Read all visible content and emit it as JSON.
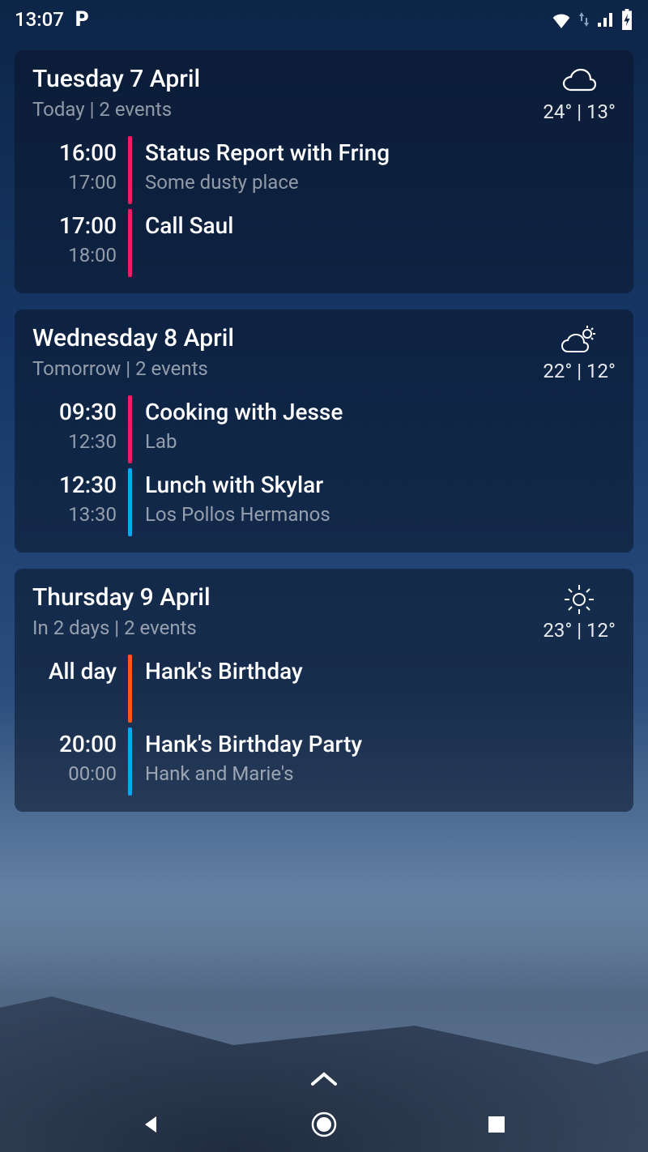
{
  "status": {
    "time": "13:07"
  },
  "colors": {
    "pink": "#e91e63",
    "blue": "#03a9f4",
    "orange": "#ff5722"
  },
  "days": [
    {
      "title": "Tuesday 7 April",
      "sub": "Today | 2 events",
      "weather": {
        "icon": "cloud",
        "temps": "24° | 13°"
      },
      "events": [
        {
          "start": "16:00",
          "end": "17:00",
          "color": "pink",
          "title": "Status Report with Fring",
          "loc": "Some dusty place"
        },
        {
          "start": "17:00",
          "end": "18:00",
          "color": "pink",
          "title": "Call Saul",
          "loc": ""
        }
      ]
    },
    {
      "title": "Wednesday 8 April",
      "sub": "Tomorrow | 2 events",
      "weather": {
        "icon": "partly",
        "temps": "22° | 12°"
      },
      "events": [
        {
          "start": "09:30",
          "end": "12:30",
          "color": "pink",
          "title": "Cooking with Jesse",
          "loc": "Lab"
        },
        {
          "start": "12:30",
          "end": "13:30",
          "color": "blue",
          "title": "Lunch with Skylar",
          "loc": "Los Pollos Hermanos"
        }
      ]
    },
    {
      "title": "Thursday 9 April",
      "sub": "In 2 days | 2 events",
      "weather": {
        "icon": "sun",
        "temps": "23° | 12°"
      },
      "events": [
        {
          "allday": "All day",
          "color": "orange",
          "title": "Hank's Birthday",
          "loc": ""
        },
        {
          "start": "20:00",
          "end": "00:00",
          "color": "blue",
          "title": "Hank's Birthday Party",
          "loc": "Hank and Marie's"
        }
      ]
    }
  ]
}
